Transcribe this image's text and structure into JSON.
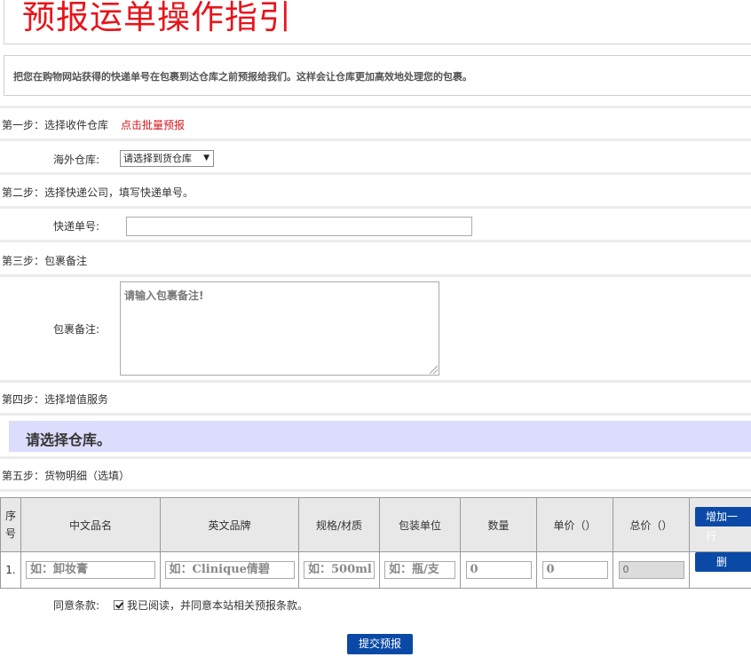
{
  "header": {
    "title": "预报运单操作指引",
    "intro": "把您在购物网站获得的快递单号在包裹到达仓库之前预报给我们。这样会让仓库更加高效地处理您的包裹。"
  },
  "step1": {
    "label": "第一步：选择收件仓库",
    "batch_link": "点击批量预报",
    "warehouse_label": "海外仓库:",
    "warehouse_select": "请选择到货仓库"
  },
  "step2": {
    "label": "第二步：选择快递公司，填写快递单号。",
    "tracking_label": "快递单号:",
    "tracking_value": ""
  },
  "step3": {
    "label": "第三步：包裹备注",
    "note_label": "包裹备注:",
    "note_placeholder": "请输入包裹备注!"
  },
  "step4": {
    "label": "第四步：选择增值服务",
    "warehouse_notice": "请选择仓库。"
  },
  "step5": {
    "label": "第五步：货物明细（选填）",
    "columns": [
      "序号",
      "中文品名",
      "英文品牌",
      "规格/材质",
      "包装单位",
      "数量",
      "单价（）",
      "总价（）"
    ],
    "add_row_label": "增加一行",
    "rows": [
      {
        "index": "1.",
        "cn_name": "如：卸妆膏",
        "en_brand": "如：Clinique倩碧",
        "spec": "如：500ml",
        "unit": "如：瓶/支",
        "qty": "0",
        "price": "0",
        "total": "0",
        "delete_label": "删除"
      }
    ]
  },
  "agreement": {
    "label": "同意条款:",
    "text": "我已阅读，并同意本站相关预报条款。"
  },
  "submit_label": "提交预报"
}
